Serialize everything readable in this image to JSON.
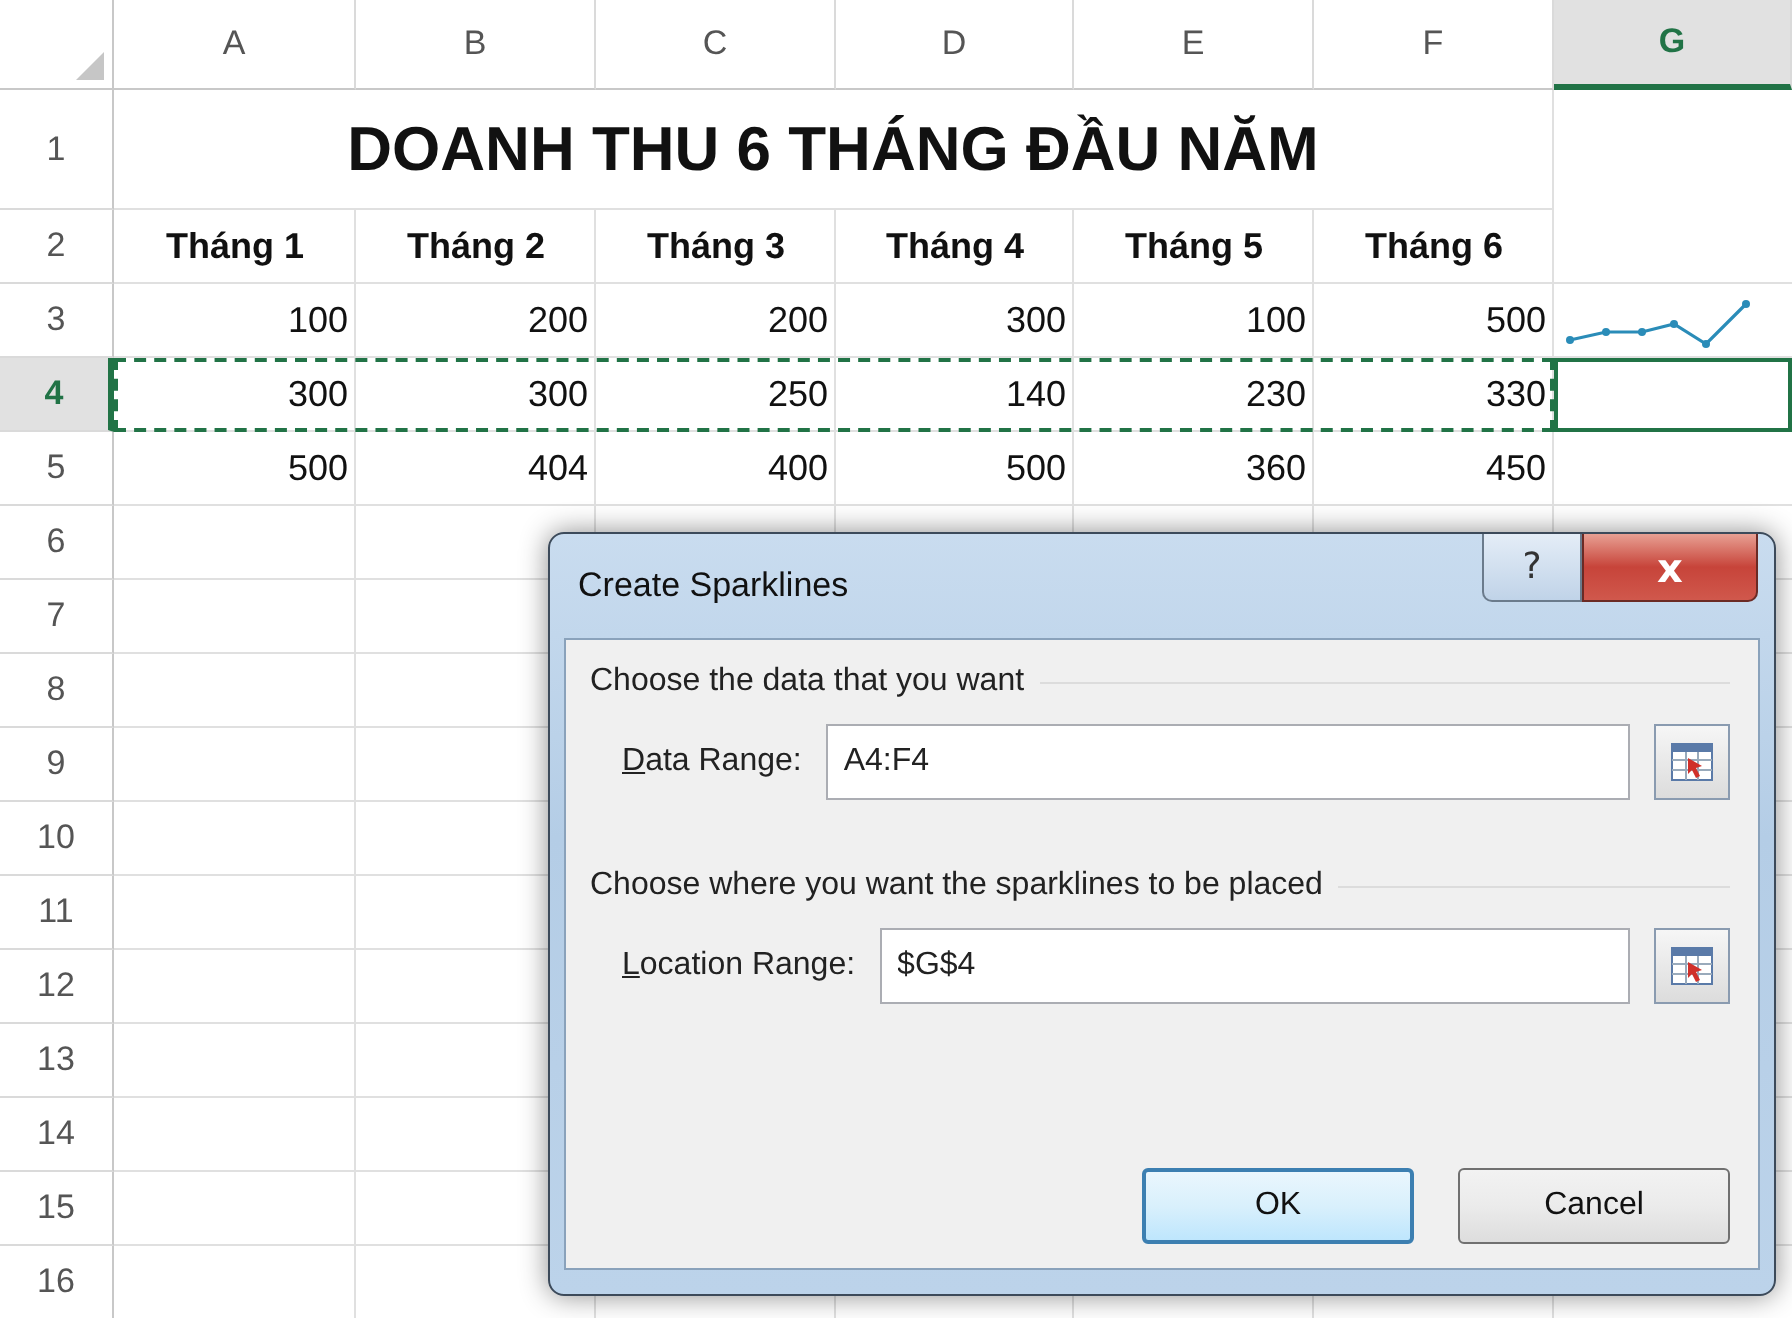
{
  "columns": [
    {
      "label": "A",
      "selected": false
    },
    {
      "label": "B",
      "selected": false
    },
    {
      "label": "C",
      "selected": false
    },
    {
      "label": "D",
      "selected": false
    },
    {
      "label": "E",
      "selected": false
    },
    {
      "label": "F",
      "selected": false
    },
    {
      "label": "G",
      "selected": true
    }
  ],
  "rows": [
    {
      "number": "1",
      "selected": false,
      "kind": "title",
      "title": "DOANH THU 6 THÁNG ĐẦU NĂM"
    },
    {
      "number": "2",
      "selected": false,
      "kind": "header",
      "cells": [
        "Tháng 1",
        "Tháng 2",
        "Tháng 3",
        "Tháng 4",
        "Tháng 5",
        "Tháng 6"
      ]
    },
    {
      "number": "3",
      "selected": false,
      "kind": "data",
      "cells": [
        "100",
        "200",
        "200",
        "300",
        "100",
        "500"
      ],
      "g_cell": {
        "kind": "sparkline",
        "selected": false
      }
    },
    {
      "number": "4",
      "selected": true,
      "kind": "data",
      "marquee": true,
      "cells": [
        "300",
        "300",
        "250",
        "140",
        "230",
        "330"
      ],
      "g_cell": {
        "kind": "blank",
        "selected": true
      }
    },
    {
      "number": "5",
      "selected": false,
      "kind": "data",
      "cells": [
        "500",
        "404",
        "400",
        "500",
        "360",
        "450"
      ]
    },
    {
      "number": "6",
      "selected": false,
      "kind": "empty"
    },
    {
      "number": "7",
      "selected": false,
      "kind": "empty"
    },
    {
      "number": "8",
      "selected": false,
      "kind": "empty"
    },
    {
      "number": "9",
      "selected": false,
      "kind": "empty"
    },
    {
      "number": "10",
      "selected": false,
      "kind": "empty"
    },
    {
      "number": "11",
      "selected": false,
      "kind": "empty"
    },
    {
      "number": "12",
      "selected": false,
      "kind": "empty"
    },
    {
      "number": "13",
      "selected": false,
      "kind": "empty"
    },
    {
      "number": "14",
      "selected": false,
      "kind": "empty"
    },
    {
      "number": "15",
      "selected": false,
      "kind": "empty"
    },
    {
      "number": "16",
      "selected": false,
      "kind": "empty"
    }
  ],
  "dialog": {
    "title": "Create Sparklines",
    "help": "?",
    "close": "x",
    "groups": [
      {
        "heading": "Choose the data that you want",
        "label": "Data Range:",
        "value": "A4:F4"
      },
      {
        "heading": "Choose where you want the sparklines to be placed",
        "label": "Location Range:",
        "value": "$G$4"
      }
    ],
    "buttons": [
      {
        "label": "OK",
        "default": true
      },
      {
        "label": "Cancel",
        "default": false
      }
    ]
  }
}
